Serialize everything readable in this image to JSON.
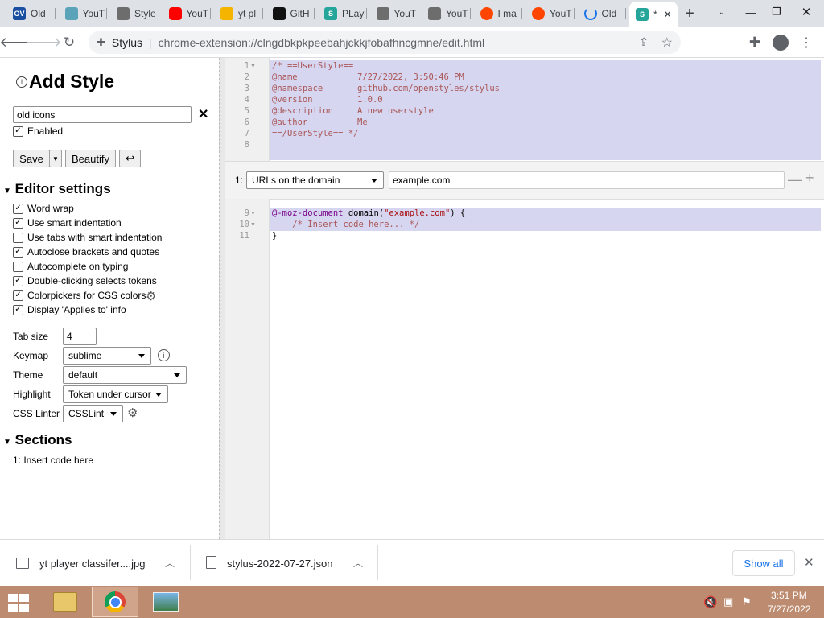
{
  "tabs": [
    {
      "title": "Old",
      "icon": "ov-icon",
      "color": "#1a4ea0"
    },
    {
      "title": "YouT",
      "icon": "tampermonkey-icon",
      "color": "#5aa3b8"
    },
    {
      "title": "Style",
      "icon": "folder-icon",
      "color": "#6d6d6d"
    },
    {
      "title": "YouT",
      "icon": "youtube-icon",
      "color": "#ff0000"
    },
    {
      "title": "yt pl",
      "icon": "google-drive-icon",
      "color": "#f4b400"
    },
    {
      "title": "GitH",
      "icon": "github-icon",
      "color": "#111111"
    },
    {
      "title": "PLay",
      "icon": "stylus-icon",
      "color": "#26a69a"
    },
    {
      "title": "YouT",
      "icon": "folder-icon",
      "color": "#6d6d6d"
    },
    {
      "title": "YouT",
      "icon": "folder-icon",
      "color": "#6d6d6d"
    },
    {
      "title": "I ma",
      "icon": "reddit-icon",
      "color": "#ff4500"
    },
    {
      "title": "YouT",
      "icon": "reddit-icon",
      "color": "#ff4500"
    },
    {
      "title": "Old",
      "icon": "loading-icon",
      "color": "#1a73e8"
    },
    {
      "title": "*",
      "icon": "stylus-icon",
      "color": "#26a69a",
      "active": true
    }
  ],
  "address_bar": {
    "site_name": "Stylus",
    "url": "chrome-extension://clngdbkpkpeebahjckkjfobafhncgmne/edit.html"
  },
  "left_panel": {
    "title": "Add Style",
    "style_name": "old icons",
    "enabled_label": "Enabled",
    "save_label": "Save",
    "beautify_label": "Beautify",
    "undo_glyph": "↩",
    "editor_settings_heading": "Editor settings",
    "settings": [
      {
        "label": "Word wrap",
        "checked": true
      },
      {
        "label": "Use smart indentation",
        "checked": true
      },
      {
        "label": "Use tabs with smart indentation",
        "checked": false
      },
      {
        "label": "Autoclose brackets and quotes",
        "checked": true
      },
      {
        "label": "Autocomplete on typing",
        "checked": false
      },
      {
        "label": "Double-clicking selects tokens",
        "checked": true
      },
      {
        "label": "Colorpickers for CSS colors",
        "checked": true
      },
      {
        "label": "Display 'Applies to' info",
        "checked": true
      }
    ],
    "tab_size_label": "Tab size",
    "tab_size_value": "4",
    "keymap_label": "Keymap",
    "keymap_value": "sublime",
    "theme_label": "Theme",
    "theme_value": "default",
    "highlight_label": "Highlight",
    "highlight_value": "Token under cursor",
    "css_linter_label": "CSS Linter",
    "css_linter_value": "CSSLint",
    "sections_heading": "Sections",
    "sections": [
      "1: Insert code here"
    ]
  },
  "editor": {
    "header_lines": [
      {
        "n": "1",
        "text": "/* ==UserStyle=="
      },
      {
        "n": "2",
        "key": "@name",
        "value": "7/27/2022, 3:50:46 PM"
      },
      {
        "n": "3",
        "key": "@namespace",
        "value": "github.com/openstyles/stylus"
      },
      {
        "n": "4",
        "key": "@version",
        "value": "1.0.0"
      },
      {
        "n": "5",
        "key": "@description",
        "value": "A new userstyle"
      },
      {
        "n": "6",
        "key": "@author",
        "value": "Me"
      },
      {
        "n": "7",
        "text": "==/UserStyle== */"
      },
      {
        "n": "8",
        "text": ""
      }
    ],
    "applies_index": "1:",
    "applies_type": "URLs on the domain",
    "applies_value": "example.com",
    "section_lines": [
      {
        "n": "9",
        "a": "@-moz-document",
        "b": " domain(",
        "c": "\"example.com\"",
        "d": ") {"
      },
      {
        "n": "10",
        "text": "    /* Insert code here... */"
      },
      {
        "n": "11",
        "text": "}"
      }
    ]
  },
  "downloads": {
    "items": [
      "yt player classifer....jpg",
      "stylus-2022-07-27.json"
    ],
    "show_all_label": "Show all"
  },
  "taskbar": {
    "time": "3:51 PM",
    "date": "7/27/2022"
  }
}
